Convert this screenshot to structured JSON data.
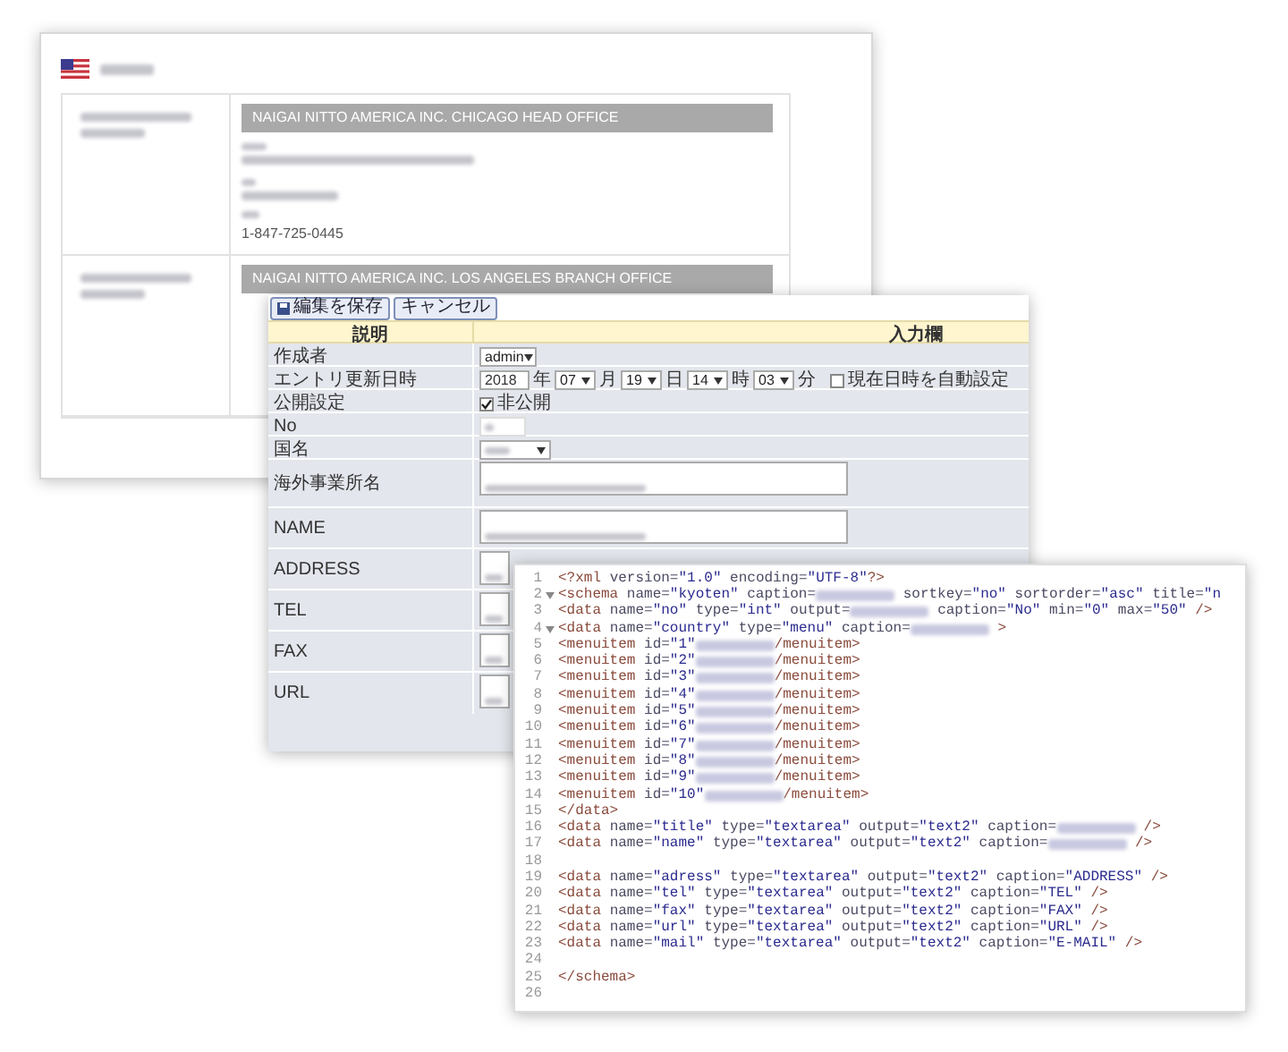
{
  "office_page": {
    "offices": [
      {
        "name": "NAIGAI NITTO AMERICA INC. CHICAGO HEAD OFFICE",
        "fax": "1-847-725-0445"
      },
      {
        "name": "NAIGAI NITTO AMERICA INC. LOS ANGELES BRANCH OFFICE"
      }
    ]
  },
  "edit_form": {
    "buttons": [
      "編集を保存",
      "キャンセル"
    ],
    "columns": [
      "説明",
      "入力欄"
    ],
    "rows": [
      {
        "kind": "select",
        "label": "作成者",
        "value": "admin"
      },
      {
        "kind": "datetime",
        "label": "エントリ更新日時",
        "year": {
          "value": "2018",
          "unit": "年"
        },
        "parts": [
          {
            "value": "07",
            "unit": "月"
          },
          {
            "value": "19",
            "unit": "日"
          },
          {
            "value": "14",
            "unit": "時"
          },
          {
            "value": "03",
            "unit": "分"
          }
        ],
        "auto": {
          "label": "現在日時を自動設定",
          "checked": false
        }
      },
      {
        "kind": "checkbox",
        "label": "公開設定",
        "option": {
          "label": "非公開",
          "checked": true
        }
      },
      {
        "kind": "input",
        "label": "No"
      },
      {
        "kind": "select",
        "label": "国名"
      },
      {
        "kind": "textarea",
        "label": "海外事業所名"
      },
      {
        "kind": "textarea",
        "label": "NAME"
      },
      {
        "kind": "textarea",
        "label": "ADDRESS"
      },
      {
        "kind": "textarea",
        "label": "TEL"
      },
      {
        "kind": "textarea",
        "label": "FAX"
      },
      {
        "kind": "textarea",
        "label": "URL"
      }
    ]
  },
  "code_editor": {
    "lines": [
      {
        "number": "1",
        "fold": false,
        "segments": [
          {
            "kind": "tag",
            "text": "<?xml"
          },
          {
            "kind": "attr",
            "text": " version="
          },
          {
            "kind": "value",
            "text": "\"1.0\""
          },
          {
            "kind": "attr",
            "text": " encoding="
          },
          {
            "kind": "value",
            "text": "\"UTF-8\""
          },
          {
            "kind": "tag",
            "text": "?>"
          }
        ]
      },
      {
        "number": "2",
        "fold": true,
        "segments": [
          {
            "kind": "tag",
            "text": "<schema"
          },
          {
            "kind": "attr",
            "text": " name="
          },
          {
            "kind": "value",
            "text": "\"kyoten\""
          },
          {
            "kind": "attr",
            "text": " caption="
          },
          {
            "kind": "blur"
          },
          {
            "kind": "attr",
            "text": " sortkey="
          },
          {
            "kind": "value",
            "text": "\"no\""
          },
          {
            "kind": "attr",
            "text": " sortorder="
          },
          {
            "kind": "value",
            "text": "\"asc\""
          },
          {
            "kind": "attr",
            "text": " title="
          },
          {
            "kind": "value",
            "text": "\"n"
          }
        ]
      },
      {
        "number": "3",
        "fold": false,
        "segments": [
          {
            "kind": "tag",
            "text": "<data"
          },
          {
            "kind": "attr",
            "text": " name="
          },
          {
            "kind": "value",
            "text": "\"no\""
          },
          {
            "kind": "attr",
            "text": " type="
          },
          {
            "kind": "value",
            "text": "\"int\""
          },
          {
            "kind": "attr",
            "text": " output="
          },
          {
            "kind": "blur"
          },
          {
            "kind": "attr",
            "text": " caption="
          },
          {
            "kind": "value",
            "text": "\"No\""
          },
          {
            "kind": "attr",
            "text": " min="
          },
          {
            "kind": "value",
            "text": "\"0\""
          },
          {
            "kind": "attr",
            "text": " max="
          },
          {
            "kind": "value",
            "text": "\"50\""
          },
          {
            "kind": "tag",
            "text": " />"
          }
        ]
      },
      {
        "number": "4",
        "fold": true,
        "segments": [
          {
            "kind": "tag",
            "text": "<data"
          },
          {
            "kind": "attr",
            "text": " name="
          },
          {
            "kind": "value",
            "text": "\"country\""
          },
          {
            "kind": "attr",
            "text": " type="
          },
          {
            "kind": "value",
            "text": "\"menu\""
          },
          {
            "kind": "attr",
            "text": " caption="
          },
          {
            "kind": "blur"
          },
          {
            "kind": "tag",
            "text": " >"
          }
        ]
      },
      {
        "number": "5",
        "fold": false,
        "segments": [
          {
            "kind": "tag",
            "text": "<menuitem"
          },
          {
            "kind": "attr",
            "text": " id="
          },
          {
            "kind": "value",
            "text": "\"1\""
          },
          {
            "kind": "blur"
          },
          {
            "kind": "tag",
            "text": "/menuitem>"
          }
        ]
      },
      {
        "number": "6",
        "fold": false,
        "segments": [
          {
            "kind": "tag",
            "text": "<menuitem"
          },
          {
            "kind": "attr",
            "text": " id="
          },
          {
            "kind": "value",
            "text": "\"2\""
          },
          {
            "kind": "blur"
          },
          {
            "kind": "tag",
            "text": "/menuitem>"
          }
        ]
      },
      {
        "number": "7",
        "fold": false,
        "segments": [
          {
            "kind": "tag",
            "text": "<menuitem"
          },
          {
            "kind": "attr",
            "text": " id="
          },
          {
            "kind": "value",
            "text": "\"3\""
          },
          {
            "kind": "blur"
          },
          {
            "kind": "tag",
            "text": "/menuitem>"
          }
        ]
      },
      {
        "number": "8",
        "fold": false,
        "segments": [
          {
            "kind": "tag",
            "text": "<menuitem"
          },
          {
            "kind": "attr",
            "text": " id="
          },
          {
            "kind": "value",
            "text": "\"4\""
          },
          {
            "kind": "blur"
          },
          {
            "kind": "tag",
            "text": "/menuitem>"
          }
        ]
      },
      {
        "number": "9",
        "fold": false,
        "segments": [
          {
            "kind": "tag",
            "text": "<menuitem"
          },
          {
            "kind": "attr",
            "text": " id="
          },
          {
            "kind": "value",
            "text": "\"5\""
          },
          {
            "kind": "blur"
          },
          {
            "kind": "tag",
            "text": "/menuitem>"
          }
        ]
      },
      {
        "number": "10",
        "fold": false,
        "segments": [
          {
            "kind": "tag",
            "text": "<menuitem"
          },
          {
            "kind": "attr",
            "text": " id="
          },
          {
            "kind": "value",
            "text": "\"6\""
          },
          {
            "kind": "blur"
          },
          {
            "kind": "tag",
            "text": "/menuitem>"
          }
        ]
      },
      {
        "number": "11",
        "fold": false,
        "segments": [
          {
            "kind": "tag",
            "text": "<menuitem"
          },
          {
            "kind": "attr",
            "text": " id="
          },
          {
            "kind": "value",
            "text": "\"7\""
          },
          {
            "kind": "blur"
          },
          {
            "kind": "tag",
            "text": "/menuitem>"
          }
        ]
      },
      {
        "number": "12",
        "fold": false,
        "segments": [
          {
            "kind": "tag",
            "text": "<menuitem"
          },
          {
            "kind": "attr",
            "text": " id="
          },
          {
            "kind": "value",
            "text": "\"8\""
          },
          {
            "kind": "blur"
          },
          {
            "kind": "tag",
            "text": "/menuitem>"
          }
        ]
      },
      {
        "number": "13",
        "fold": false,
        "segments": [
          {
            "kind": "tag",
            "text": "<menuitem"
          },
          {
            "kind": "attr",
            "text": " id="
          },
          {
            "kind": "value",
            "text": "\"9\""
          },
          {
            "kind": "blur"
          },
          {
            "kind": "tag",
            "text": "/menuitem>"
          }
        ]
      },
      {
        "number": "14",
        "fold": false,
        "segments": [
          {
            "kind": "tag",
            "text": "<menuitem"
          },
          {
            "kind": "attr",
            "text": " id="
          },
          {
            "kind": "value",
            "text": "\"10\""
          },
          {
            "kind": "blur"
          },
          {
            "kind": "tag",
            "text": "/menuitem>"
          }
        ]
      },
      {
        "number": "15",
        "fold": false,
        "segments": [
          {
            "kind": "tag",
            "text": "</data>"
          }
        ]
      },
      {
        "number": "16",
        "fold": false,
        "segments": [
          {
            "kind": "tag",
            "text": "<data"
          },
          {
            "kind": "attr",
            "text": " name="
          },
          {
            "kind": "value",
            "text": "\"title\""
          },
          {
            "kind": "attr",
            "text": " type="
          },
          {
            "kind": "value",
            "text": "\"textarea\""
          },
          {
            "kind": "attr",
            "text": " output="
          },
          {
            "kind": "value",
            "text": "\"text2\""
          },
          {
            "kind": "attr",
            "text": " caption="
          },
          {
            "kind": "blur"
          },
          {
            "kind": "tag",
            "text": " />"
          }
        ]
      },
      {
        "number": "17",
        "fold": false,
        "segments": [
          {
            "kind": "tag",
            "text": "<data"
          },
          {
            "kind": "attr",
            "text": " name="
          },
          {
            "kind": "value",
            "text": "\"name\""
          },
          {
            "kind": "attr",
            "text": " type="
          },
          {
            "kind": "value",
            "text": "\"textarea\""
          },
          {
            "kind": "attr",
            "text": " output="
          },
          {
            "kind": "value",
            "text": "\"text2\""
          },
          {
            "kind": "attr",
            "text": " caption="
          },
          {
            "kind": "blur"
          },
          {
            "kind": "tag",
            "text": " />"
          }
        ]
      },
      {
        "number": "18",
        "fold": false
      },
      {
        "number": "19",
        "fold": false,
        "segments": [
          {
            "kind": "tag",
            "text": "<data"
          },
          {
            "kind": "attr",
            "text": " name="
          },
          {
            "kind": "value",
            "text": "\"adress\""
          },
          {
            "kind": "attr",
            "text": " type="
          },
          {
            "kind": "value",
            "text": "\"textarea\""
          },
          {
            "kind": "attr",
            "text": " output="
          },
          {
            "kind": "value",
            "text": "\"text2\""
          },
          {
            "kind": "attr",
            "text": " caption="
          },
          {
            "kind": "value",
            "text": "\"ADDRESS\""
          },
          {
            "kind": "tag",
            "text": " />"
          }
        ]
      },
      {
        "number": "20",
        "fold": false,
        "segments": [
          {
            "kind": "tag",
            "text": "<data"
          },
          {
            "kind": "attr",
            "text": " name="
          },
          {
            "kind": "value",
            "text": "\"tel\""
          },
          {
            "kind": "attr",
            "text": " type="
          },
          {
            "kind": "value",
            "text": "\"textarea\""
          },
          {
            "kind": "attr",
            "text": " output="
          },
          {
            "kind": "value",
            "text": "\"text2\""
          },
          {
            "kind": "attr",
            "text": " caption="
          },
          {
            "kind": "value",
            "text": "\"TEL\""
          },
          {
            "kind": "tag",
            "text": " />"
          }
        ]
      },
      {
        "number": "21",
        "fold": false,
        "segments": [
          {
            "kind": "tag",
            "text": "<data"
          },
          {
            "kind": "attr",
            "text": " name="
          },
          {
            "kind": "value",
            "text": "\"fax\""
          },
          {
            "kind": "attr",
            "text": " type="
          },
          {
            "kind": "value",
            "text": "\"textarea\""
          },
          {
            "kind": "attr",
            "text": " output="
          },
          {
            "kind": "value",
            "text": "\"text2\""
          },
          {
            "kind": "attr",
            "text": " caption="
          },
          {
            "kind": "value",
            "text": "\"FAX\""
          },
          {
            "kind": "tag",
            "text": " />"
          }
        ]
      },
      {
        "number": "22",
        "fold": false,
        "segments": [
          {
            "kind": "tag",
            "text": "<data"
          },
          {
            "kind": "attr",
            "text": " name="
          },
          {
            "kind": "value",
            "text": "\"url\""
          },
          {
            "kind": "attr",
            "text": " type="
          },
          {
            "kind": "value",
            "text": "\"textarea\""
          },
          {
            "kind": "attr",
            "text": " output="
          },
          {
            "kind": "value",
            "text": "\"text2\""
          },
          {
            "kind": "attr",
            "text": " caption="
          },
          {
            "kind": "value",
            "text": "\"URL\""
          },
          {
            "kind": "tag",
            "text": " />"
          }
        ]
      },
      {
        "number": "23",
        "fold": false,
        "segments": [
          {
            "kind": "tag",
            "text": "<data"
          },
          {
            "kind": "attr",
            "text": " name="
          },
          {
            "kind": "value",
            "text": "\"mail\""
          },
          {
            "kind": "attr",
            "text": " type="
          },
          {
            "kind": "value",
            "text": "\"textarea\""
          },
          {
            "kind": "attr",
            "text": " output="
          },
          {
            "kind": "value",
            "text": "\"text2\""
          },
          {
            "kind": "attr",
            "text": " caption="
          },
          {
            "kind": "value",
            "text": "\"E-MAIL\""
          },
          {
            "kind": "tag",
            "text": " />"
          }
        ]
      },
      {
        "number": "24",
        "fold": false
      },
      {
        "number": "25",
        "fold": false,
        "segments": [
          {
            "kind": "tag",
            "text": "</schema>"
          }
        ]
      },
      {
        "number": "26",
        "fold": false
      }
    ]
  }
}
